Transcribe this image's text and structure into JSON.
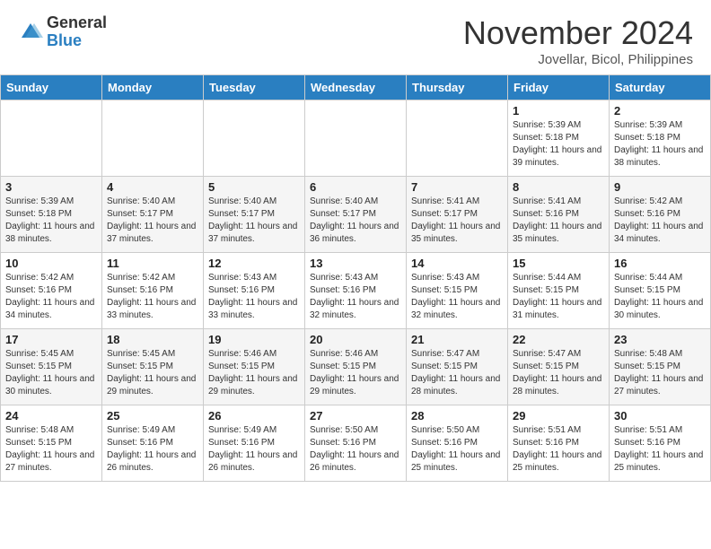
{
  "header": {
    "logo_line1": "General",
    "logo_line2": "Blue",
    "month": "November 2024",
    "location": "Jovellar, Bicol, Philippines"
  },
  "weekdays": [
    "Sunday",
    "Monday",
    "Tuesday",
    "Wednesday",
    "Thursday",
    "Friday",
    "Saturday"
  ],
  "weeks": [
    [
      {
        "day": "",
        "sunrise": "",
        "sunset": "",
        "daylight": ""
      },
      {
        "day": "",
        "sunrise": "",
        "sunset": "",
        "daylight": ""
      },
      {
        "day": "",
        "sunrise": "",
        "sunset": "",
        "daylight": ""
      },
      {
        "day": "",
        "sunrise": "",
        "sunset": "",
        "daylight": ""
      },
      {
        "day": "",
        "sunrise": "",
        "sunset": "",
        "daylight": ""
      },
      {
        "day": "1",
        "sunrise": "Sunrise: 5:39 AM",
        "sunset": "Sunset: 5:18 PM",
        "daylight": "Daylight: 11 hours and 39 minutes."
      },
      {
        "day": "2",
        "sunrise": "Sunrise: 5:39 AM",
        "sunset": "Sunset: 5:18 PM",
        "daylight": "Daylight: 11 hours and 38 minutes."
      }
    ],
    [
      {
        "day": "3",
        "sunrise": "Sunrise: 5:39 AM",
        "sunset": "Sunset: 5:18 PM",
        "daylight": "Daylight: 11 hours and 38 minutes."
      },
      {
        "day": "4",
        "sunrise": "Sunrise: 5:40 AM",
        "sunset": "Sunset: 5:17 PM",
        "daylight": "Daylight: 11 hours and 37 minutes."
      },
      {
        "day": "5",
        "sunrise": "Sunrise: 5:40 AM",
        "sunset": "Sunset: 5:17 PM",
        "daylight": "Daylight: 11 hours and 37 minutes."
      },
      {
        "day": "6",
        "sunrise": "Sunrise: 5:40 AM",
        "sunset": "Sunset: 5:17 PM",
        "daylight": "Daylight: 11 hours and 36 minutes."
      },
      {
        "day": "7",
        "sunrise": "Sunrise: 5:41 AM",
        "sunset": "Sunset: 5:17 PM",
        "daylight": "Daylight: 11 hours and 35 minutes."
      },
      {
        "day": "8",
        "sunrise": "Sunrise: 5:41 AM",
        "sunset": "Sunset: 5:16 PM",
        "daylight": "Daylight: 11 hours and 35 minutes."
      },
      {
        "day": "9",
        "sunrise": "Sunrise: 5:42 AM",
        "sunset": "Sunset: 5:16 PM",
        "daylight": "Daylight: 11 hours and 34 minutes."
      }
    ],
    [
      {
        "day": "10",
        "sunrise": "Sunrise: 5:42 AM",
        "sunset": "Sunset: 5:16 PM",
        "daylight": "Daylight: 11 hours and 34 minutes."
      },
      {
        "day": "11",
        "sunrise": "Sunrise: 5:42 AM",
        "sunset": "Sunset: 5:16 PM",
        "daylight": "Daylight: 11 hours and 33 minutes."
      },
      {
        "day": "12",
        "sunrise": "Sunrise: 5:43 AM",
        "sunset": "Sunset: 5:16 PM",
        "daylight": "Daylight: 11 hours and 33 minutes."
      },
      {
        "day": "13",
        "sunrise": "Sunrise: 5:43 AM",
        "sunset": "Sunset: 5:16 PM",
        "daylight": "Daylight: 11 hours and 32 minutes."
      },
      {
        "day": "14",
        "sunrise": "Sunrise: 5:43 AM",
        "sunset": "Sunset: 5:15 PM",
        "daylight": "Daylight: 11 hours and 32 minutes."
      },
      {
        "day": "15",
        "sunrise": "Sunrise: 5:44 AM",
        "sunset": "Sunset: 5:15 PM",
        "daylight": "Daylight: 11 hours and 31 minutes."
      },
      {
        "day": "16",
        "sunrise": "Sunrise: 5:44 AM",
        "sunset": "Sunset: 5:15 PM",
        "daylight": "Daylight: 11 hours and 30 minutes."
      }
    ],
    [
      {
        "day": "17",
        "sunrise": "Sunrise: 5:45 AM",
        "sunset": "Sunset: 5:15 PM",
        "daylight": "Daylight: 11 hours and 30 minutes."
      },
      {
        "day": "18",
        "sunrise": "Sunrise: 5:45 AM",
        "sunset": "Sunset: 5:15 PM",
        "daylight": "Daylight: 11 hours and 29 minutes."
      },
      {
        "day": "19",
        "sunrise": "Sunrise: 5:46 AM",
        "sunset": "Sunset: 5:15 PM",
        "daylight": "Daylight: 11 hours and 29 minutes."
      },
      {
        "day": "20",
        "sunrise": "Sunrise: 5:46 AM",
        "sunset": "Sunset: 5:15 PM",
        "daylight": "Daylight: 11 hours and 29 minutes."
      },
      {
        "day": "21",
        "sunrise": "Sunrise: 5:47 AM",
        "sunset": "Sunset: 5:15 PM",
        "daylight": "Daylight: 11 hours and 28 minutes."
      },
      {
        "day": "22",
        "sunrise": "Sunrise: 5:47 AM",
        "sunset": "Sunset: 5:15 PM",
        "daylight": "Daylight: 11 hours and 28 minutes."
      },
      {
        "day": "23",
        "sunrise": "Sunrise: 5:48 AM",
        "sunset": "Sunset: 5:15 PM",
        "daylight": "Daylight: 11 hours and 27 minutes."
      }
    ],
    [
      {
        "day": "24",
        "sunrise": "Sunrise: 5:48 AM",
        "sunset": "Sunset: 5:15 PM",
        "daylight": "Daylight: 11 hours and 27 minutes."
      },
      {
        "day": "25",
        "sunrise": "Sunrise: 5:49 AM",
        "sunset": "Sunset: 5:16 PM",
        "daylight": "Daylight: 11 hours and 26 minutes."
      },
      {
        "day": "26",
        "sunrise": "Sunrise: 5:49 AM",
        "sunset": "Sunset: 5:16 PM",
        "daylight": "Daylight: 11 hours and 26 minutes."
      },
      {
        "day": "27",
        "sunrise": "Sunrise: 5:50 AM",
        "sunset": "Sunset: 5:16 PM",
        "daylight": "Daylight: 11 hours and 26 minutes."
      },
      {
        "day": "28",
        "sunrise": "Sunrise: 5:50 AM",
        "sunset": "Sunset: 5:16 PM",
        "daylight": "Daylight: 11 hours and 25 minutes."
      },
      {
        "day": "29",
        "sunrise": "Sunrise: 5:51 AM",
        "sunset": "Sunset: 5:16 PM",
        "daylight": "Daylight: 11 hours and 25 minutes."
      },
      {
        "day": "30",
        "sunrise": "Sunrise: 5:51 AM",
        "sunset": "Sunset: 5:16 PM",
        "daylight": "Daylight: 11 hours and 25 minutes."
      }
    ]
  ]
}
